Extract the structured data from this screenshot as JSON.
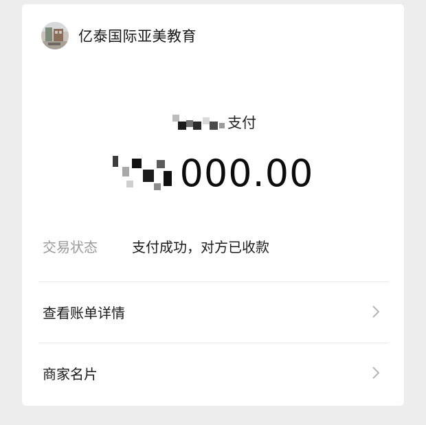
{
  "merchant": {
    "name": "亿泰国际亚美教育"
  },
  "payment": {
    "label": "支付",
    "amount_suffix": "000.00"
  },
  "status": {
    "label": "交易状态",
    "value": "支付成功，对方已收款"
  },
  "links": {
    "bill_details": "查看账单详情",
    "merchant_card": "商家名片"
  },
  "icons": {
    "chevron": "chevron-right-icon",
    "avatar": "merchant-avatar"
  },
  "colors": {
    "background": "#ededed",
    "card": "#ffffff",
    "text": "#111111",
    "muted": "#9a9a9a",
    "divider": "#e9e9e9",
    "chevron": "#b5b5b5"
  }
}
